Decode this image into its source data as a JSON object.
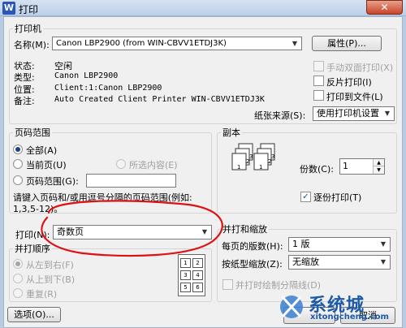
{
  "window": {
    "app_icon": "W",
    "title": "打印",
    "close_label": "✕"
  },
  "printer": {
    "group_label": "打印机",
    "name_label": "名称(M):",
    "name_value": "Canon LBP2900 (from WIN-CBVV1ETDJ3K)",
    "properties_button": "属性(P)...",
    "status_label": "状态:",
    "status_value": "空闲",
    "type_label": "类型:",
    "type_value": "Canon LBP2900",
    "location_label": "位置:",
    "location_value": "Client:1:Canon LBP2900",
    "comment_label": "备注:",
    "comment_value": "Auto Created Client Printer WIN-CBVV1ETDJ3K",
    "manual_duplex": "手动双面打印(X)",
    "reverse_print": "反片打印(I)",
    "print_to_file": "打印到文件(L)",
    "paper_source_label": "纸张来源(S):",
    "paper_source_value": "使用打印机设置"
  },
  "page_range": {
    "group_label": "页码范围",
    "all": "全部(A)",
    "current": "当前页(U)",
    "selection": "所选内容(E)",
    "pages": "页码范围(G):",
    "pages_value": "",
    "hint_line1": "请键入页码和/或用逗号分隔的页码范围(例如:",
    "hint_line2": "1,3,5-12)。"
  },
  "print_what": {
    "label": "打印(N):",
    "value": "奇数页"
  },
  "copies": {
    "group_label": "副本",
    "count_label": "份数(C):",
    "count_value": "1",
    "collate_label": "逐份打印(T)",
    "collate_checked": true
  },
  "order": {
    "group_label": "并打顺序",
    "left_to_right": "从左到右(F)",
    "top_to_bottom": "从上到下(B)",
    "repeat": "重复(R)",
    "grid_numbers": [
      "1",
      "2",
      "3",
      "4",
      "5",
      "6"
    ]
  },
  "zoom": {
    "group_label": "并打和缩放",
    "pages_per_sheet_label": "每页的版数(H):",
    "pages_per_sheet_value": "1 版",
    "scale_label": "按纸型缩放(Z):",
    "scale_value": "无缩放",
    "draw_borders": "并打时绘制分隔线(D)"
  },
  "footer": {
    "options_button": "选项(O)...",
    "cancel_button": "取消"
  },
  "watermark": {
    "text": "系统城",
    "url": "xitongcheng.com"
  },
  "colors": {
    "annotation": "#dd1111"
  }
}
